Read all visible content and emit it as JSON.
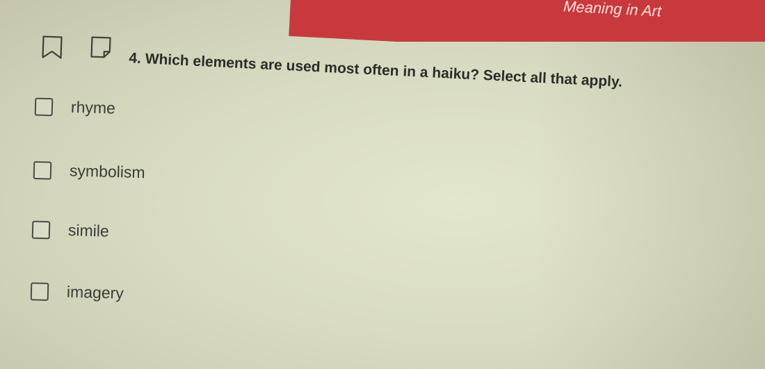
{
  "header": {
    "title": "Meaning in Art",
    "accent_color": "#c8393e"
  },
  "toolbar": {
    "bookmark_icon": "bookmark-icon",
    "note_icon": "note-icon"
  },
  "question": {
    "text": "4. Which elements are used most often in a haiku? Select all that apply.",
    "options": [
      {
        "label": "rhyme",
        "checked": false
      },
      {
        "label": "symbolism",
        "checked": false
      },
      {
        "label": "simile",
        "checked": false
      },
      {
        "label": "imagery",
        "checked": false
      }
    ]
  }
}
